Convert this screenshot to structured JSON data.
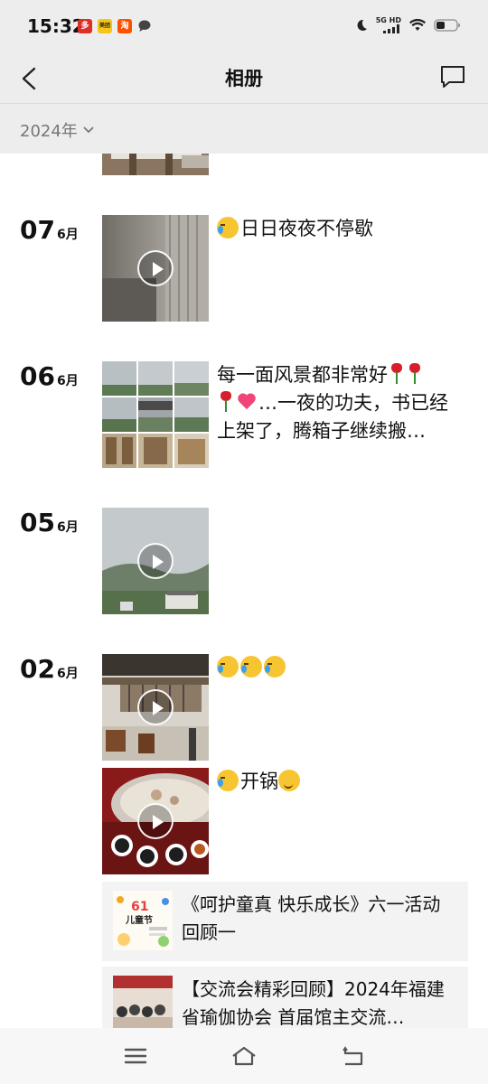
{
  "status_bar": {
    "time": "15:32",
    "apps": [
      {
        "name": "pinduoduo",
        "glyph": "多",
        "color": "#e02e24"
      },
      {
        "name": "meituan",
        "glyph": "美团",
        "color": "#f5c518"
      },
      {
        "name": "taobao",
        "glyph": "淘",
        "color": "#ff5000"
      }
    ],
    "network_label": "5G HD"
  },
  "nav": {
    "title": "相册"
  },
  "year_filter": {
    "label": "2024年"
  },
  "posts": [
    {
      "day": "07",
      "month": "6月",
      "media": "video",
      "text": "日日夜夜不停歇"
    },
    {
      "day": "06",
      "month": "6月",
      "media": "photo-grid",
      "text_line1": "每一面风景都非常好",
      "text_line2": "…一夜的功夫，书已经",
      "text_line3": "上架了，腾箱子继续搬…"
    },
    {
      "day": "05",
      "month": "6月",
      "media": "video"
    },
    {
      "day": "02",
      "month": "6月",
      "media": "video",
      "text": ""
    },
    {
      "media": "video",
      "text": "开锅"
    }
  ],
  "articles": [
    {
      "title": "《呵护童真 快乐成长》六一活动回顾一",
      "thumb_text": "61 儿童节"
    },
    {
      "title": "【交流会精彩回顾】2024年福建省瑜伽协会 首届馆主交流…"
    }
  ]
}
